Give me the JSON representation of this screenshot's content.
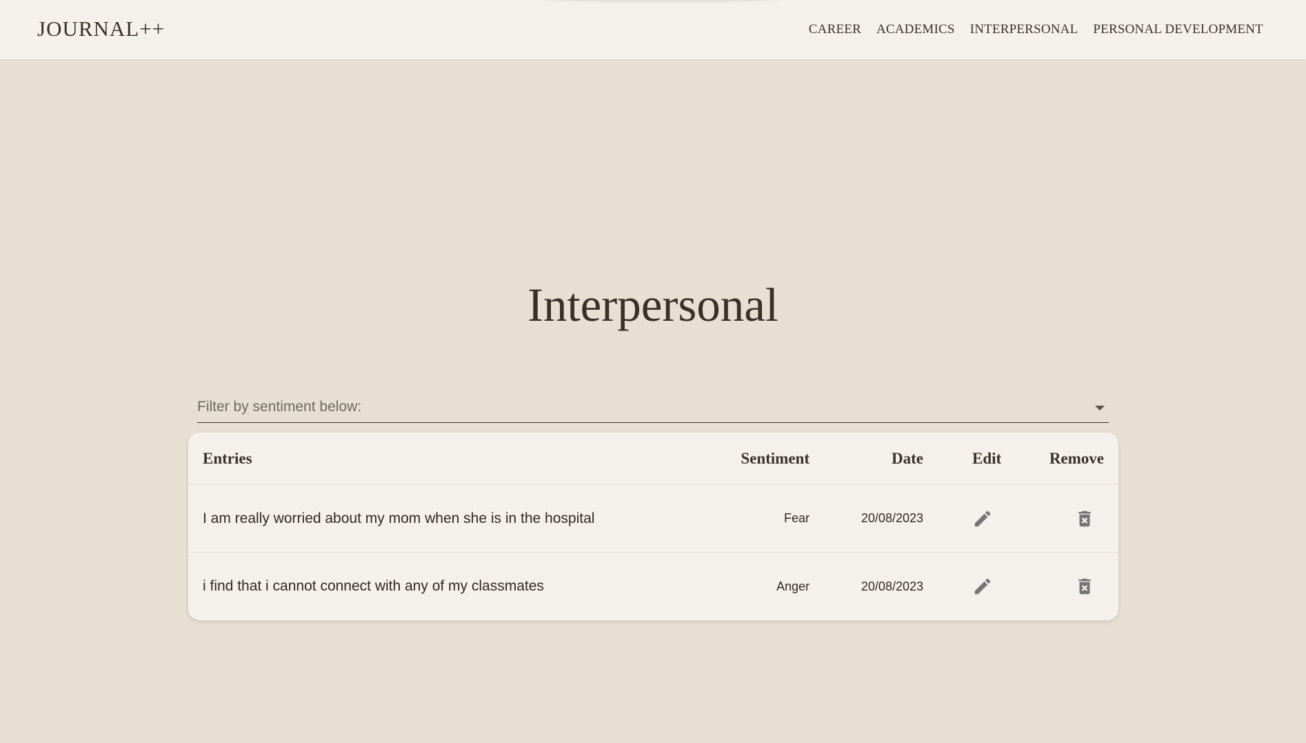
{
  "app": {
    "brand": "JOURNAL++"
  },
  "nav": {
    "items": [
      {
        "label": "CAREER"
      },
      {
        "label": "ACADEMICS"
      },
      {
        "label": "INTERPERSONAL"
      },
      {
        "label": "PERSONAL DEVELOPMENT"
      }
    ]
  },
  "page": {
    "title": "Interpersonal"
  },
  "filter": {
    "label": "Filter by sentiment below:"
  },
  "table": {
    "headers": {
      "entries": "Entries",
      "sentiment": "Sentiment",
      "date": "Date",
      "edit": "Edit",
      "remove": "Remove"
    },
    "rows": [
      {
        "entry": "I am really worried about my mom when she is in the hospital",
        "sentiment": "Fear",
        "date": "20/08/2023"
      },
      {
        "entry": "i find that i cannot connect with any of my classmates",
        "sentiment": "Anger",
        "date": "20/08/2023"
      }
    ]
  },
  "icons": {
    "edit": "pencil-icon",
    "remove": "trash-icon",
    "dropdown": "caret-down-icon"
  },
  "colors": {
    "background": "#e6dfd2",
    "navbar": "#f4f1ec",
    "card": "#f4f1ec",
    "text": "#3b3029",
    "icon": "#757575"
  }
}
